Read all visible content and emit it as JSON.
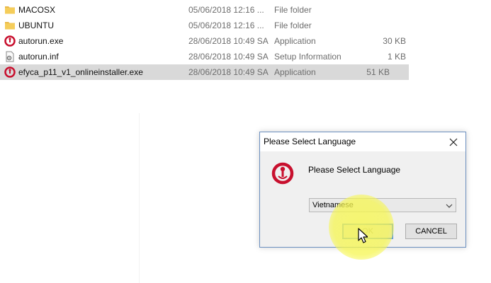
{
  "files": [
    {
      "name": "MACOSX",
      "date": "05/06/2018 12:16 ...",
      "type": "File folder",
      "size": "",
      "icon": "folder-icon",
      "selected": false
    },
    {
      "name": "UBUNTU",
      "date": "05/06/2018 12:16 ...",
      "type": "File folder",
      "size": "",
      "icon": "folder-icon",
      "selected": false
    },
    {
      "name": "autorun.exe",
      "date": "28/06/2018 10:49 SA",
      "type": "Application",
      "size": "30 KB",
      "icon": "app-logo-icon",
      "selected": false
    },
    {
      "name": "autorun.inf",
      "date": "28/06/2018 10:49 SA",
      "type": "Setup Information",
      "size": "1 KB",
      "icon": "settings-file-icon",
      "selected": false
    },
    {
      "name": "efyca_p11_v1_onlineinstaller.exe",
      "date": "28/06/2018 10:49 SA",
      "type": "Application",
      "size": "51 KB",
      "icon": "app-logo-icon",
      "selected": true
    }
  ],
  "dialog": {
    "title": "Please Select Language",
    "prompt": "Please Select Language",
    "language_selected": "Vietnamese",
    "ok_label": "OK",
    "cancel_label": "CANCEL"
  },
  "colors": {
    "selection": "#d9d9d9",
    "dialog_border": "#6b8fbf",
    "brand_red": "#c8102e",
    "highlight": "#f6f65a"
  }
}
